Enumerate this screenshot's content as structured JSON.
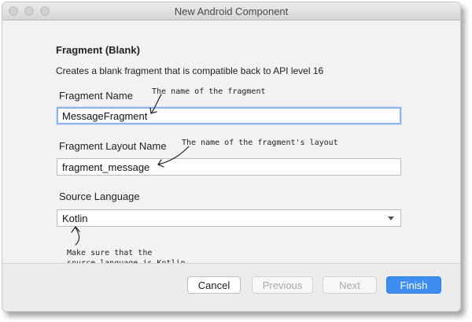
{
  "window": {
    "title": "New Android Component"
  },
  "header": {
    "heading": "Fragment (Blank)",
    "description": "Creates a blank fragment that is compatible back to API level 16"
  },
  "form": {
    "fragment_name": {
      "label": "Fragment Name",
      "value": "MessageFragment"
    },
    "layout_name": {
      "label": "Fragment Layout Name",
      "value": "fragment_message"
    },
    "source_language": {
      "label": "Source Language",
      "selected": "Kotlin"
    }
  },
  "annotations": {
    "fragment_name_note": "The name of the fragment",
    "layout_name_note": "The name of the fragment's layout",
    "language_note_line1": "Make sure that the",
    "language_note_line2": "source language is Kotlin."
  },
  "buttons": {
    "cancel": "Cancel",
    "previous": "Previous",
    "next": "Next",
    "finish": "Finish"
  },
  "colors": {
    "accent": "#3d8ef0",
    "focus_ring": "#8fb5e8"
  }
}
